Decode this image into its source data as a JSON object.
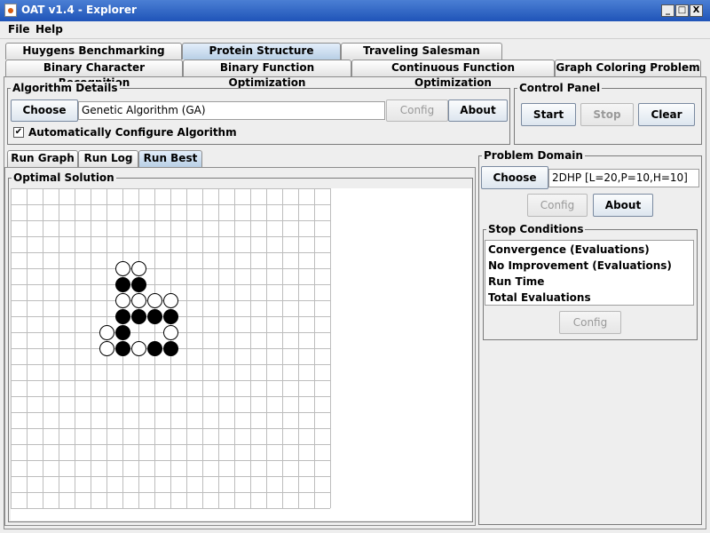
{
  "window": {
    "title": "OAT v1.4 - Explorer",
    "minimize": "_",
    "maximize": "□",
    "close": "X"
  },
  "menu": {
    "file": "File",
    "help": "Help"
  },
  "problem_tabs_row1": [
    "Huygens Benchmarking Server",
    "Protein Structure Prediction",
    "Traveling Salesman Problem"
  ],
  "problem_tabs_row2": [
    "Binary Character Recognition",
    "Binary Function Optimization",
    "Continuous Function Optimization",
    "Graph Coloring Problem"
  ],
  "selected_problem_tab": "Protein Structure Prediction",
  "algorithm": {
    "group_title": "Algorithm Details",
    "choose": "Choose",
    "value": "Genetic Algorithm (GA)",
    "config": "Config",
    "about": "About",
    "auto_config_label": "Automatically Configure Algorithm",
    "auto_config_checked": true
  },
  "control": {
    "group_title": "Control Panel",
    "start": "Start",
    "stop": "Stop",
    "clear": "Clear"
  },
  "run_tabs": [
    "Run Graph",
    "Run Log",
    "Run Best"
  ],
  "selected_run_tab": "Run Best",
  "optimal_solution": {
    "group_title": "Optimal Solution",
    "grid_cols": 20,
    "grid_rows": 20,
    "white_cells": [
      [
        7,
        5
      ],
      [
        8,
        5
      ],
      [
        7,
        7
      ],
      [
        8,
        7
      ],
      [
        9,
        7
      ],
      [
        10,
        7
      ],
      [
        6,
        9
      ],
      [
        10,
        9
      ],
      [
        6,
        10
      ],
      [
        8,
        10
      ]
    ],
    "black_cells": [
      [
        7,
        6
      ],
      [
        8,
        6
      ],
      [
        7,
        8
      ],
      [
        8,
        8
      ],
      [
        9,
        8
      ],
      [
        10,
        8
      ],
      [
        7,
        9
      ],
      [
        7,
        10
      ],
      [
        9,
        10
      ],
      [
        10,
        10
      ]
    ]
  },
  "problem_domain": {
    "group_title": "Problem Domain",
    "choose": "Choose",
    "value": "2DHP [L=20,P=10,H=10]",
    "config": "Config",
    "about": "About"
  },
  "stop_conditions": {
    "group_title": "Stop Conditions",
    "items": [
      "Convergence (Evaluations)",
      "No Improvement (Evaluations)",
      "Run Time",
      "Total Evaluations"
    ],
    "config": "Config"
  }
}
